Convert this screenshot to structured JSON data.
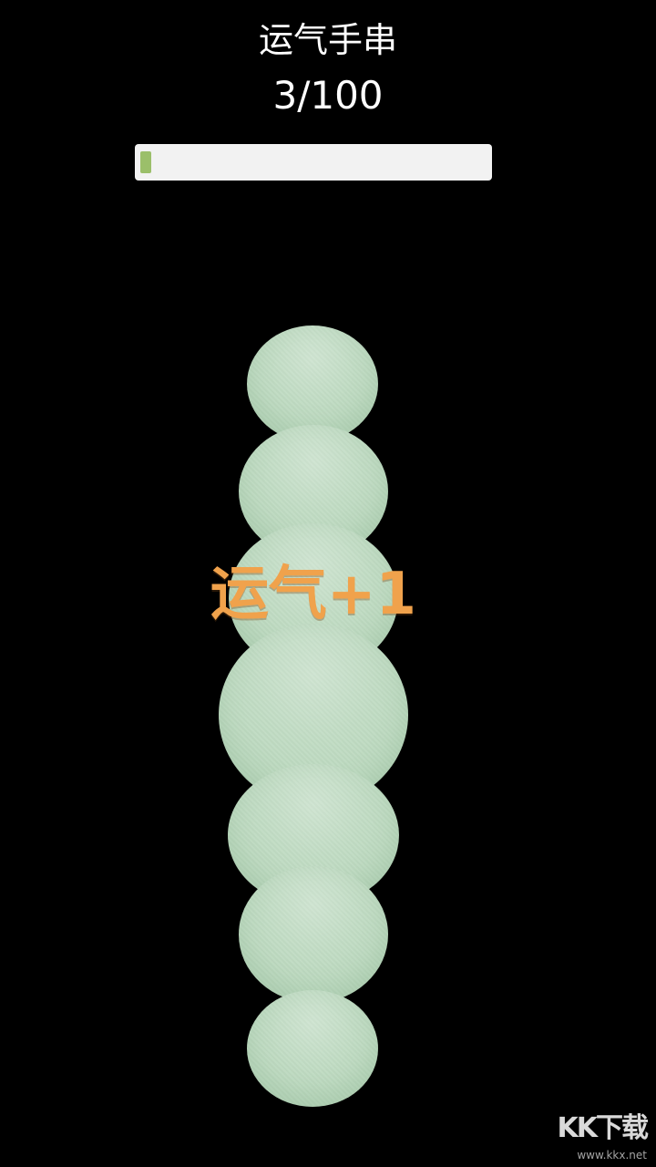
{
  "game": {
    "title": "运气手串",
    "counter": "3/100",
    "progress": {
      "current": 3,
      "total": 100
    },
    "popup_text": "运气+1",
    "bead_count": 7
  },
  "colors": {
    "background": "#000000",
    "title_text": "#ffffff",
    "progress_track": "#f2f2f2",
    "progress_fill": "#9bbf6a",
    "bead": "#bcd9bf",
    "popup_text": "#f0a24c"
  },
  "watermark": {
    "logo": "KK下载",
    "url": "www.kkx.net"
  }
}
